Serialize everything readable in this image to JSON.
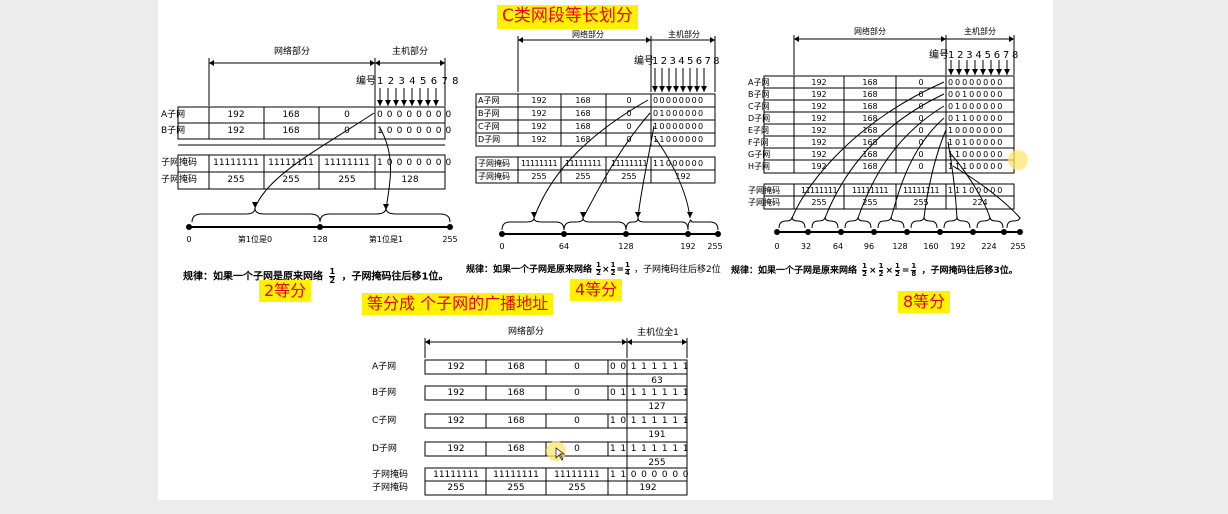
{
  "title": "C类网段等长划分",
  "labels": {
    "network_part": "网络部分",
    "host_part": "主机部分",
    "host_all_one": "主机位全1",
    "numbering": "编号",
    "bit_numbers": "1 2 3 4 5 6 7 8",
    "subnet_mask": "子网掩码"
  },
  "tags": {
    "two": "2等分",
    "four": "4等分",
    "eight": "8等分",
    "broadcast": "等分成 个子网的广播地址"
  },
  "panel2": {
    "rows": [
      {
        "name": "A子网",
        "c1": "192",
        "c2": "168",
        "c3": "0",
        "bits": "0 0 0 0 0 0 0 0"
      },
      {
        "name": "B子网",
        "c1": "192",
        "c2": "168",
        "c3": "0",
        "bits": "1 0 0 0 0 0 0 0"
      }
    ],
    "mask_bits": {
      "c1": "11111111",
      "c2": "11111111",
      "c3": "11111111",
      "bits": "1 0 0 0 0 0 0 0"
    },
    "mask_dec": {
      "c1": "255",
      "c2": "255",
      "c3": "255",
      "c4": "128"
    },
    "axis": [
      "0",
      "128",
      "255"
    ],
    "ranges": [
      "第1位是0",
      "第1位是1"
    ],
    "rule": "规律：如果一个子网是原来网络",
    "rule_tail": "，子网掩码往后移1位。"
  },
  "panel4": {
    "rows": [
      {
        "name": "A子网",
        "c1": "192",
        "c2": "168",
        "c3": "0",
        "bits": "0 0 0 0 0 0 0 0"
      },
      {
        "name": "B子网",
        "c1": "192",
        "c2": "168",
        "c3": "0",
        "bits": "0 1 0 0 0 0 0 0"
      },
      {
        "name": "C子网",
        "c1": "192",
        "c2": "168",
        "c3": "0",
        "bits": "1 0 0 0 0 0 0 0"
      },
      {
        "name": "D子网",
        "c1": "192",
        "c2": "168",
        "c3": "0",
        "bits": "1 1 0 0 0 0 0 0"
      }
    ],
    "mask_bits": {
      "c1": "11111111",
      "c2": "11111111",
      "c3": "11111111",
      "bits": "1 1 0 0 0 0 0 0"
    },
    "mask_dec": {
      "c1": "255",
      "c2": "255",
      "c3": "255",
      "c4": "192"
    },
    "axis": [
      "0",
      "64",
      "128",
      "192",
      "255"
    ],
    "rule": "规律：如果一个子网是原来网络",
    "rule_tail": "，子网掩码往后移2位"
  },
  "panel8": {
    "rows": [
      {
        "name": "A子网",
        "c1": "192",
        "c2": "168",
        "c3": "0",
        "bits": "0 0 0 0 0 0 0 0"
      },
      {
        "name": "B子网",
        "c1": "192",
        "c2": "168",
        "c3": "0",
        "bits": "0 0 1 0 0 0 0 0"
      },
      {
        "name": "C子网",
        "c1": "192",
        "c2": "168",
        "c3": "0",
        "bits": "0 1 0 0 0 0 0 0"
      },
      {
        "name": "D子网",
        "c1": "192",
        "c2": "168",
        "c3": "0",
        "bits": "0 1 1 0 0 0 0 0"
      },
      {
        "name": "E子网",
        "c1": "192",
        "c2": "168",
        "c3": "0",
        "bits": "1 0 0 0 0 0 0 0"
      },
      {
        "name": "F子网",
        "c1": "192",
        "c2": "168",
        "c3": "0",
        "bits": "1 0 1 0 0 0 0 0"
      },
      {
        "name": "G子网",
        "c1": "192",
        "c2": "168",
        "c3": "0",
        "bits": "1 1 0 0 0 0 0 0"
      },
      {
        "name": "H子网",
        "c1": "192",
        "c2": "168",
        "c3": "0",
        "bits": "1 1 1 0 0 0 0 0"
      }
    ],
    "mask_bits": {
      "c1": "11111111",
      "c2": "11111111",
      "c3": "11111111",
      "bits": "1 1 1 0 0 0 0 0"
    },
    "mask_dec": {
      "c1": "255",
      "c2": "255",
      "c3": "255",
      "c4": "224"
    },
    "axis": [
      "0",
      "32",
      "64",
      "96",
      "128",
      "160",
      "192",
      "224",
      "255"
    ],
    "rule": "规律：如果一个子网是原来网络",
    "rule_tail": "，子网掩码往后移3位。"
  },
  "fractions": {
    "half": {
      "n": "1",
      "d": "2"
    },
    "quarter": {
      "n": "1",
      "d": "4"
    },
    "eighth": {
      "n": "1",
      "d": "8"
    },
    "times": "×",
    "equals": "="
  },
  "broadcast": {
    "rows": [
      {
        "name": "A子网",
        "c1": "192",
        "c2": "168",
        "c3": "0",
        "bits": "0 0 1 1 1 1 1 1",
        "value": "63"
      },
      {
        "name": "B子网",
        "c1": "192",
        "c2": "168",
        "c3": "0",
        "bits": "0 1 1 1 1 1 1 1",
        "value": "127"
      },
      {
        "name": "C子网",
        "c1": "192",
        "c2": "168",
        "c3": "0",
        "bits": "1 0 1 1 1 1 1 1",
        "value": "191"
      },
      {
        "name": "D子网",
        "c1": "192",
        "c2": "168",
        "c3": "0",
        "bits": "1 1 1 1 1 1 1 1",
        "value": "255"
      }
    ],
    "mask_bits": {
      "c1": "11111111",
      "c2": "11111111",
      "c3": "11111111",
      "bits": "1 1 0 0 0 0 0 0"
    },
    "mask_dec": {
      "c1": "255",
      "c2": "255",
      "c3": "255",
      "c4": "192"
    }
  },
  "colors": {
    "tag_bg": "#fff200",
    "tag_fg": "#e8001c",
    "cursor_glow": "#ffe66b"
  }
}
